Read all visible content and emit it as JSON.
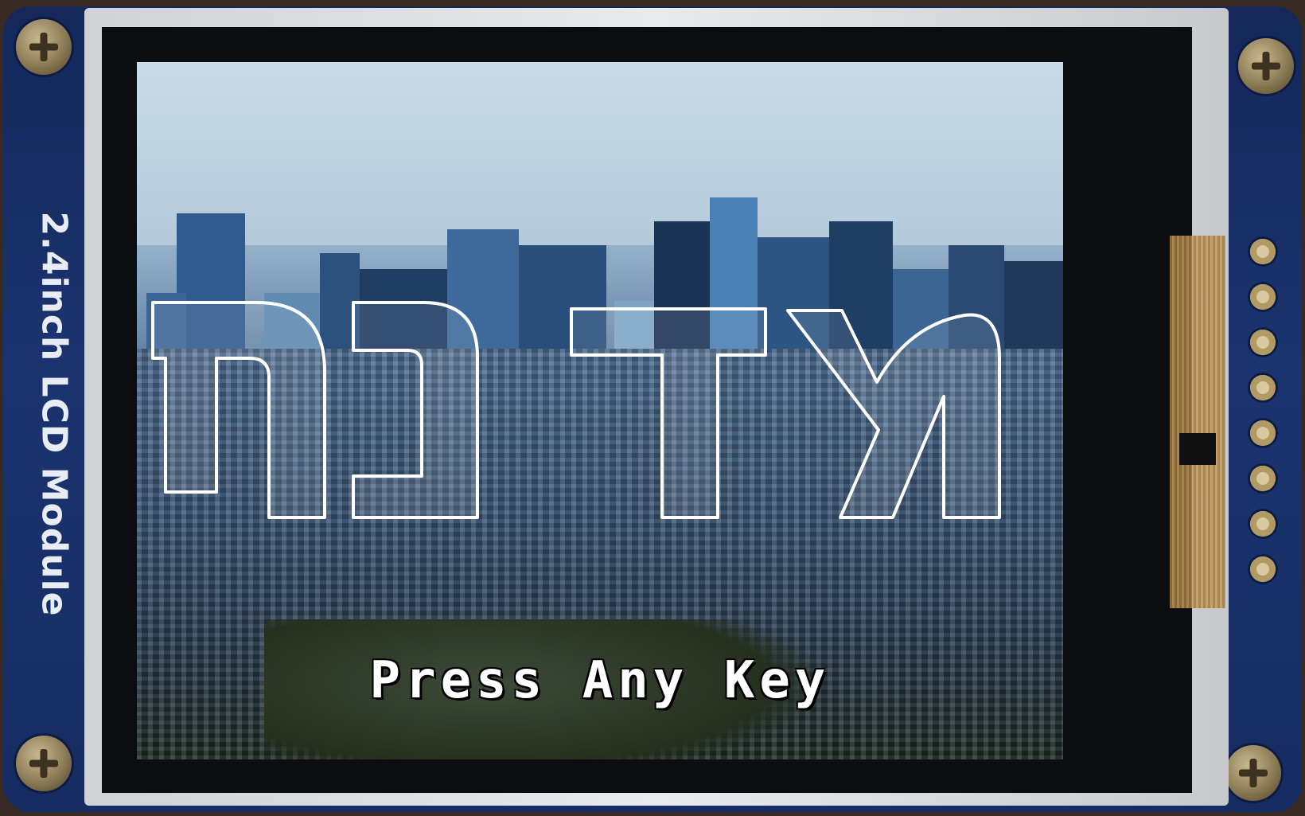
{
  "board": {
    "label": "2.4inch LCD Module",
    "colors": {
      "pcb": "#1b3470",
      "frame": "#e8ebec"
    }
  },
  "screen": {
    "prompt": "Press Any Key",
    "logo_icon": "outlined-hebrew-letters-logo",
    "colors": {
      "sky": "#b4cadb",
      "buildings": "#2b4f7e",
      "text": "#ffffff"
    }
  }
}
